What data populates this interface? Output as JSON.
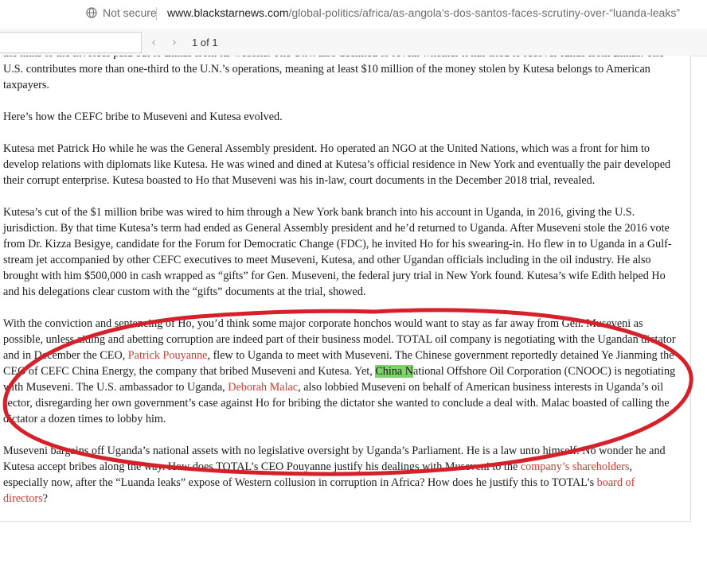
{
  "browser": {
    "security_label": "Not secure",
    "url_domain": "www.blackstarnews.com",
    "url_path": "/global-politics/africa/as-angola’s-dos-santos-faces-scrutiny-over-“luanda-leaks”"
  },
  "pdf_toolbar": {
    "prev_icon": "‹",
    "next_icon": "›",
    "page_current": "1",
    "page_of": "of 1"
  },
  "article": {
    "p0": "the links to the invoices paid out to Enhas from its website. The U.N. also declined to reveal whether it has tried to recover funds from Enhas. The U.S. contributes more than one-third to the U.N.’s operations, meaning at least $10 million of the money stolen by Kutesa belongs to American taxpayers.",
    "p1": "Here’s how the CEFC bribe to Museveni and Kutesa evolved.",
    "p2": "Kutesa met Patrick Ho while he was the General Assembly president. Ho operated an NGO at the United Nations, which was a front for him to develop relations with diplomats like Kutesa. He was wined and dined at Kutesa’s official residence in New York and eventually the pair developed their corrupt enterprise. Kutesa boasted to Ho that Museveni was his in-law, court documents in the December 2018 trial, revealed.",
    "p3": "Kutesa’s cut of the $1 million bribe was wired to him through a New York bank branch into his account in Uganda, in 2016, giving the U.S. jurisdiction. By that time Kutesa’s term had ended as General Assembly president and he’d returned to Uganda. After Museveni stole the 2016 vote from Dr. Kizza Besigye, candidate for the Forum for Democratic Change (FDC), he invited Ho for his swearing-in. Ho flew in to Uganda in a Gulf-stream jet accompanied by other CEFC executives to meet Museveni, Kutesa, and other Ugandan officials including in the oil industry. He also brought with him $500,000 in cash wrapped as “gifts” for Gen. Museveni, the federal jury trial in New York found. Kutesa’s wife Edith helped Ho and his delegations clear custom with the “gifts” documents at the trial, showed.",
    "p4a": "With the conviction and sentencing of Ho, you’d think some major corporate honchos would want to stay as far away from Gen. Museveni as possible, unless aiding and abetting corruption are indeed part of their business model. TOTAL oil company is negotiating with the Ugandan dictator and in December the CEO, ",
    "p4_link1": "Patrick Pouyanne",
    "p4b": ", flew to Uganda to meet with Museveni. The Chinese government reportedly detained Ye Jianming the CEO of CEFC China Energy, the company that bribed Museveni and Kutesa. Yet, ",
    "p4_highlight": "China N",
    "p4c": "ational Offshore Oil Corporation (CNOOC) is negotiating with Museveni. The U.S. ambassador to Uganda, ",
    "p4_link2": "Deborah Malac",
    "p4d": ", also lobbied Museveni on behalf of American business interests in Uganda’s oil sector, disregarding her own government’s case against Ho for bribing the dictator she wanted to conclude a deal with. Malac boasted of calling the dictator a dozen times to lobby him.",
    "p5a": "Museveni bargains off Uganda’s national assets with no legislative oversight by Uganda’s Parliament. He is a law unto himself. No wonder he and Kutesa accept bribes along the way. How does TOTAL’s CEO Pouyanne justify his dealings with Museveni to the ",
    "p5_link1": "company’s shareholders",
    "p5b": ", especially now, after the “Luanda leaks” expose of Western collusion in corruption in Africa? How does he justify this to TOTAL’s ",
    "p5_link2": "board of directors",
    "p5c": "?"
  },
  "colors": {
    "link": "#cc3e33",
    "highlight": "#7fd16a",
    "annotation": "#d6202a"
  },
  "icons": [
    "globe-icon",
    "chevron-left-icon",
    "chevron-right-icon"
  ]
}
